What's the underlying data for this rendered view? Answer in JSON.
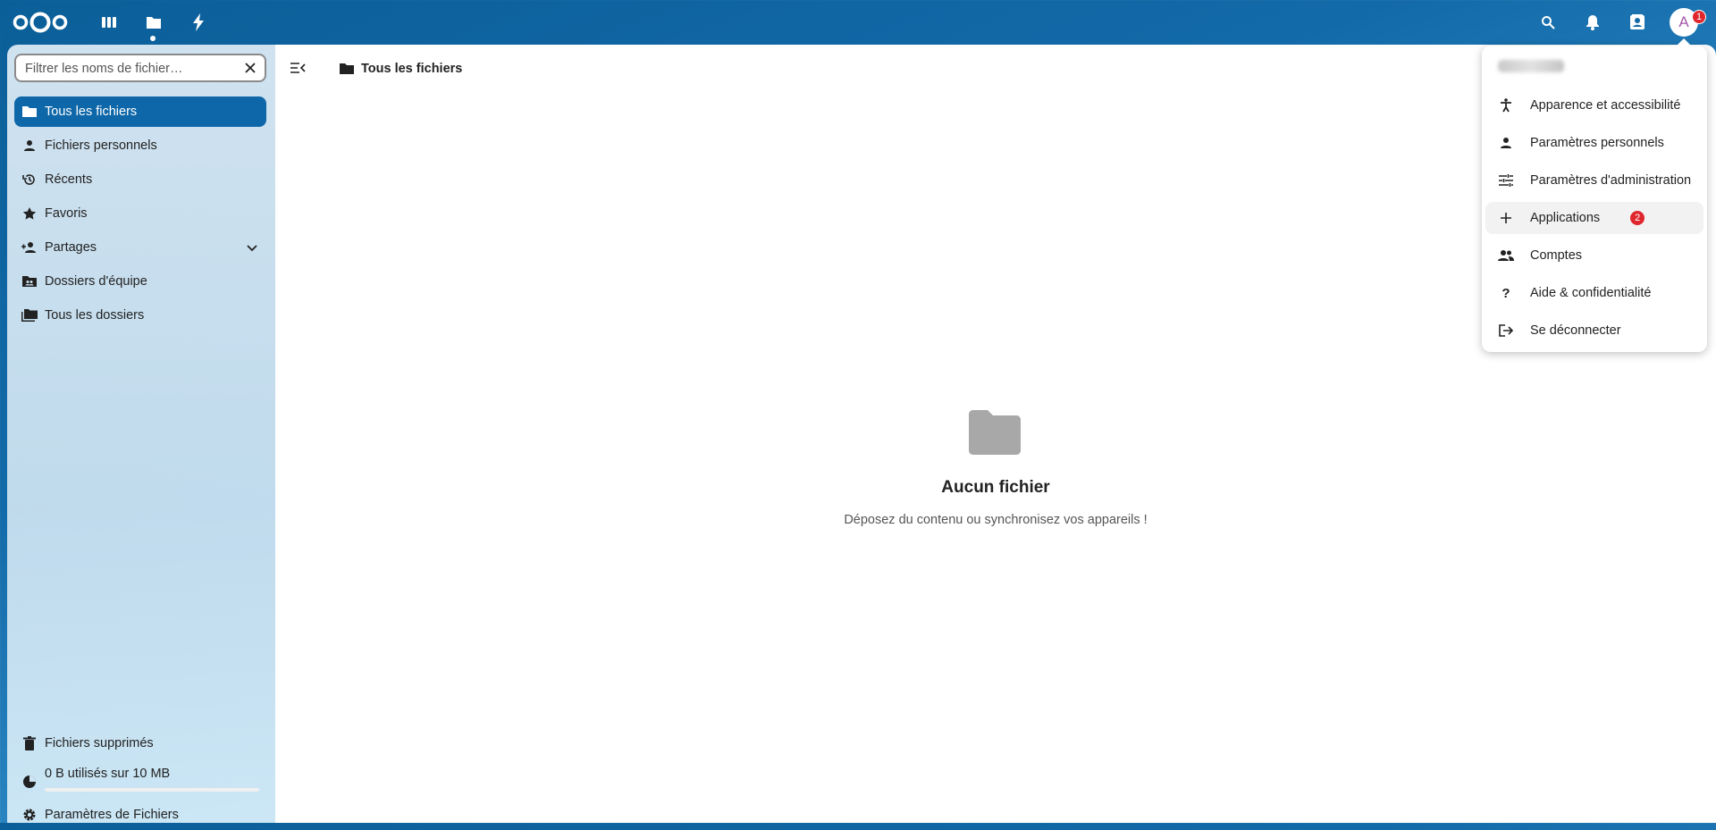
{
  "topbar": {
    "apps": [
      {
        "name": "dashboard",
        "icon": "dashboard-icon"
      },
      {
        "name": "files",
        "icon": "folder-icon",
        "active": true
      },
      {
        "name": "activity",
        "icon": "lightning-icon"
      }
    ],
    "right_icons": [
      "search-icon",
      "bell-icon",
      "contacts-icon"
    ],
    "avatar_letter": "A",
    "avatar_badge": "1"
  },
  "sidebar": {
    "filter_placeholder": "Filtrer les noms de fichier…",
    "items": [
      {
        "label": "Tous les fichiers",
        "icon": "folder-icon",
        "active": true
      },
      {
        "label": "Fichiers personnels",
        "icon": "person-icon"
      },
      {
        "label": "Récents",
        "icon": "history-icon"
      },
      {
        "label": "Favoris",
        "icon": "star-icon"
      },
      {
        "label": "Partages",
        "icon": "share-icon",
        "expandable": true
      },
      {
        "label": "Dossiers d'équipe",
        "icon": "team-folder-icon"
      },
      {
        "label": "Tous les dossiers",
        "icon": "folders-icon"
      }
    ],
    "trash_label": "Fichiers supprimés",
    "quota_label": "0 B utilisés sur 10 MB",
    "quota_fraction": 0,
    "settings_label": "Paramètres de Fichiers"
  },
  "main": {
    "breadcrumb_label": "Tous les fichiers",
    "empty_title": "Aucun fichier",
    "empty_desc": "Déposez du contenu ou synchronisez vos appareils !"
  },
  "user_menu": {
    "items": [
      {
        "label": "Apparence et accessibilité",
        "icon": "accessibility-icon"
      },
      {
        "label": "Paramètres personnels",
        "icon": "person-icon"
      },
      {
        "label": "Paramètres d'administration",
        "icon": "tune-icon"
      },
      {
        "label": "Applications",
        "icon": "plus-icon",
        "badge": "2",
        "hover": true
      },
      {
        "label": "Comptes",
        "icon": "accounts-icon"
      },
      {
        "label": "Aide & confidentialité",
        "icon": "help-icon"
      },
      {
        "label": "Se déconnecter",
        "icon": "logout-icon"
      }
    ]
  },
  "colors": {
    "primary": "#0e67a8",
    "badge": "#e0262d",
    "avatar_text": "#a358a8"
  }
}
